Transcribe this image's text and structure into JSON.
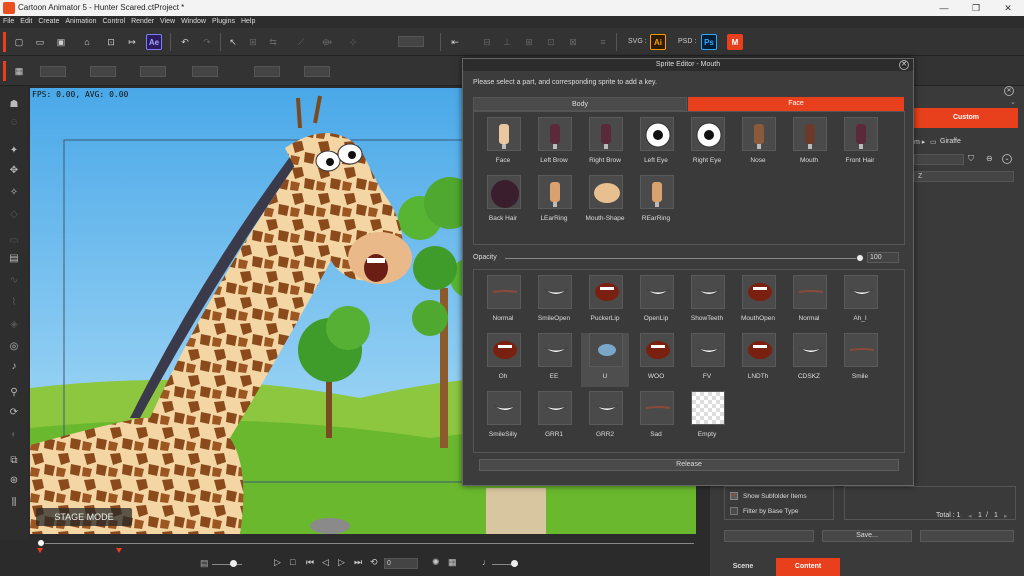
{
  "window": {
    "title": "Cartoon Animator 5 - Hunter Scared.ctProject *",
    "controls": [
      "—",
      "❐",
      "✕"
    ]
  },
  "menu": [
    "File",
    "Edit",
    "Create",
    "Animation",
    "Control",
    "Render",
    "View",
    "Window",
    "Plugins",
    "Help"
  ],
  "toolbar": {
    "svg_label": "SVG :",
    "psd_label": "PSD :",
    "ai_badge": "Ai",
    "ps_badge": "Ps",
    "ae_badge": "Ae",
    "m_badge": "M"
  },
  "stage": {
    "fps_text": "FPS: 0.00, AVG: 0.00",
    "mode_label": "STAGE MODE"
  },
  "timeline": {
    "frame_value": "0"
  },
  "right_panel": {
    "custom_tab": "Custom",
    "breadcrumb_sep": "m ▸",
    "folder": "Giraffe",
    "dropdown_value": "Z",
    "show_subfolder": "Show Subfolder Items",
    "filter_base": "Filter by Base Type",
    "total_label": "Total : 1",
    "page_current": "1",
    "page_sep": "/",
    "page_total": "1",
    "save_button": "Save...",
    "scene_tab": "Scene",
    "content_tab": "Content"
  },
  "dialog": {
    "title": "Sprite Editor - Mouth",
    "instruction": "Please select a part, and corresponding sprite to add a key.",
    "tabs": [
      "Body",
      "Face"
    ],
    "active_tab": "Face",
    "parts": [
      "Face",
      "Left Brow",
      "Right Brow",
      "Left Eye",
      "Right Eye",
      "Nose",
      "Mouth",
      "Front Hair",
      "Back Hair",
      "LEarRing",
      "Mouth-Shape",
      "REarRing"
    ],
    "opacity_label": "Opacity",
    "opacity_value": "100",
    "sprites": [
      "Normal",
      "SmileOpen",
      "PuckerLip",
      "OpenLip",
      "ShowTeeth",
      "MouthOpen",
      "Normal",
      "Ah_I",
      "Oh",
      "EE",
      "U",
      "WOO",
      "FV",
      "LNDTh",
      "CDSKZ",
      "Smile",
      "SmileSilly",
      "GRR1",
      "GRR2",
      "Sad",
      "Empty"
    ],
    "selected_sprite": "U",
    "release_button": "Release"
  },
  "colors": {
    "accent": "#e8401c",
    "stage_bg": "#7fc8ef",
    "panel": "#3c3c3c"
  }
}
